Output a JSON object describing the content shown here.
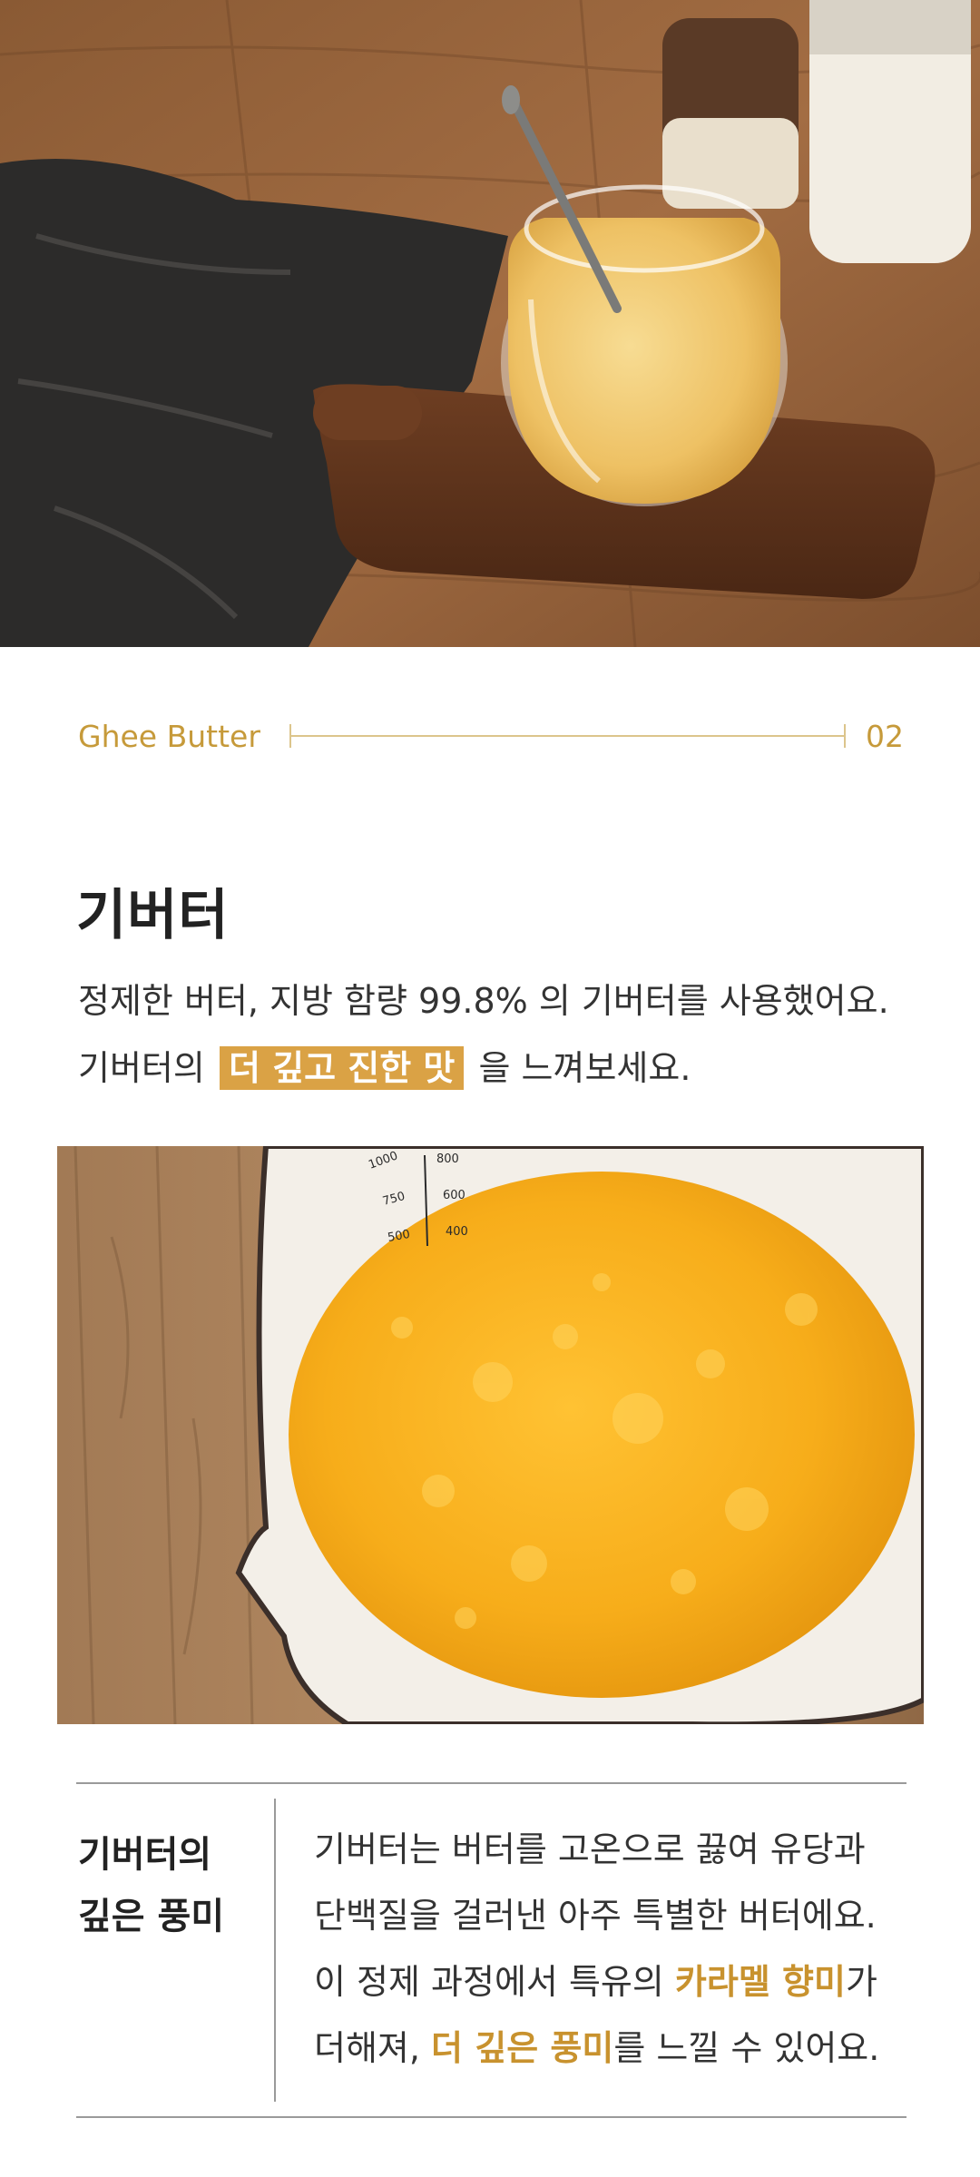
{
  "hero_image": {
    "alt": "glass jar of ghee butter with spoon on wooden board"
  },
  "section_label": {
    "brand": "Ghee Butter",
    "number": "02"
  },
  "title": "기버터",
  "intro": {
    "line1": "정제한 버터, 지방 함량 99.8% 의 기버터를 사용했어요.",
    "line2_before": "기버터의",
    "line2_highlight": "더 깊고 진한 맛",
    "line2_after": "을 느껴보세요."
  },
  "second_image": {
    "alt": "melted butter in a white enamel measuring pot",
    "scale_marks": [
      "1000",
      "750",
      "500",
      "800",
      "600",
      "400"
    ]
  },
  "info": {
    "side_line1": "기버터의",
    "side_line2": "깊은 풍미",
    "body_line1": "기버터는 버터를 고온으로 끓여 유당과",
    "body_line2": "단백질을 걸러낸 아주 특별한 버터에요.",
    "body_line3_before": "이 정제 과정에서 특유의 ",
    "body_line3_accent": "카라멜 향미",
    "body_line3_after": "가",
    "body_line4_before": "더해져, ",
    "body_line4_accent": "더 깊은 풍미",
    "body_line4_after": "를 느낄 수 있어요."
  },
  "colors": {
    "accent": "#c8922e",
    "highlight_bg": "#daa245",
    "rule": "#dcc58c"
  }
}
